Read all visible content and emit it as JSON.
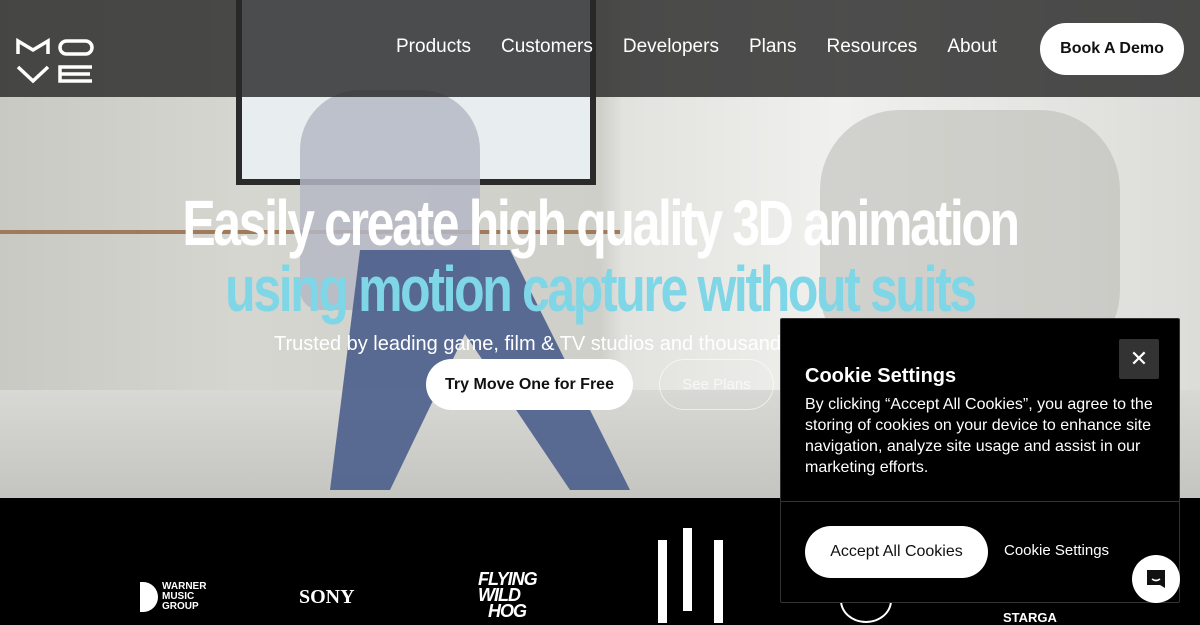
{
  "nav": {
    "logo": "MOVE",
    "links": [
      "Products",
      "Customers",
      "Developers",
      "Plans",
      "Resources",
      "About"
    ],
    "cta": "Book A Demo"
  },
  "hero": {
    "line1": "Easily create high quality 3D animation",
    "line2": "using motion capture without suits",
    "subtitle": "Trusted by leading game, film & TV studios and thousands",
    "primary": "Try Move One for Free",
    "secondary": "See Plans",
    "accent": "#7fd6e6"
  },
  "logos": {
    "warner": [
      "WARNER",
      "MUSIC",
      "GROUP"
    ],
    "sony": "SONY",
    "fwh": [
      "FLYING",
      "WILD",
      "HOG"
    ],
    "stargate": "STARGA"
  },
  "cookie": {
    "title": "Cookie Settings",
    "body": "By clicking “Accept All Cookies”, you agree to the storing of cookies on your device to enhance site navigation, analyze site usage and assist in our marketing efforts.",
    "accept": "Accept All Cookies",
    "settings": "Cookie Settings"
  }
}
